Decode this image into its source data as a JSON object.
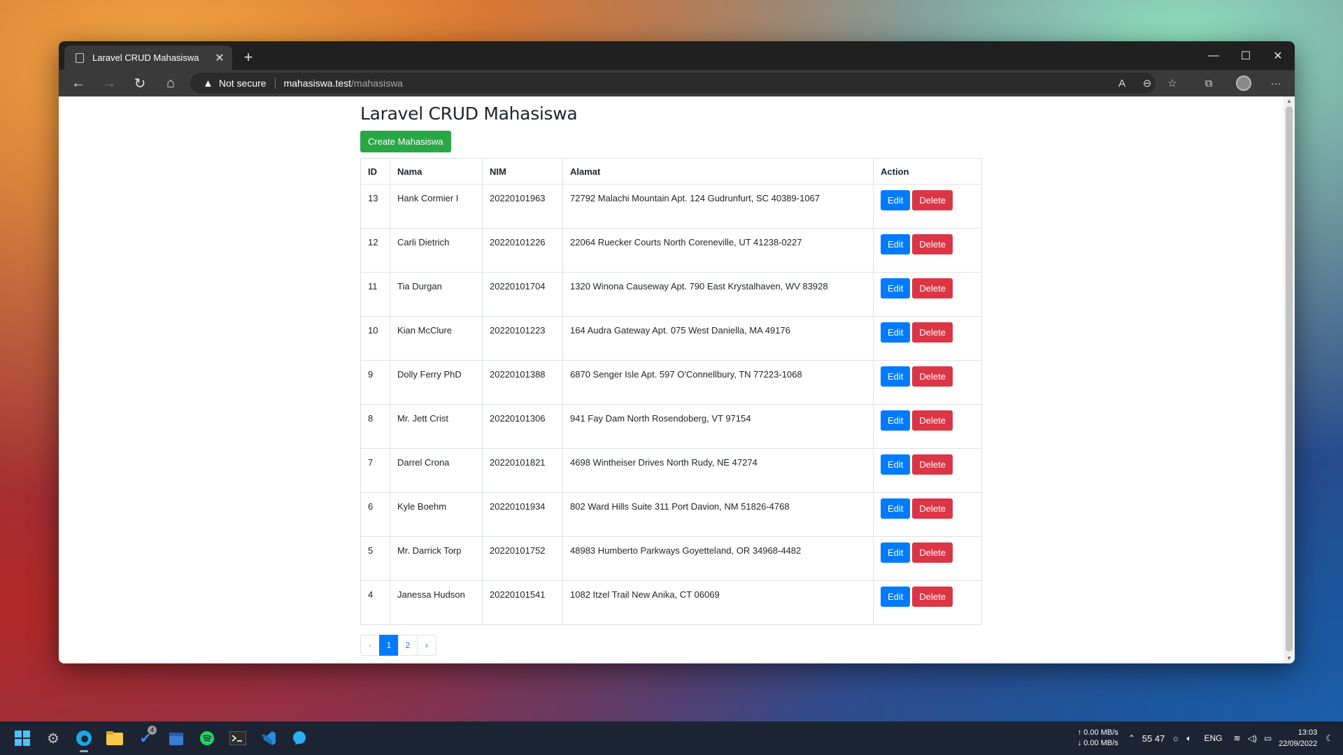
{
  "browser": {
    "tab_title": "Laravel CRUD Mahasiswa",
    "security_label": "Not secure",
    "url_host": "mahasiswa.test",
    "url_path": "/mahasiswa"
  },
  "page": {
    "title": "Laravel CRUD Mahasiswa",
    "create_button": "Create Mahasiswa",
    "columns": [
      "ID",
      "Nama",
      "NIM",
      "Alamat",
      "Action"
    ],
    "edit_label": "Edit",
    "delete_label": "Delete",
    "rows": [
      {
        "id": "13",
        "nama": "Hank Cormier I",
        "nim": "20220101963",
        "alamat": "72792 Malachi Mountain Apt. 124 Gudrunfurt, SC 40389-1067"
      },
      {
        "id": "12",
        "nama": "Carli Dietrich",
        "nim": "20220101226",
        "alamat": "22064 Ruecker Courts North Coreneville, UT 41238-0227"
      },
      {
        "id": "11",
        "nama": "Tia Durgan",
        "nim": "20220101704",
        "alamat": "1320 Winona Causeway Apt. 790 East Krystalhaven, WV 83928"
      },
      {
        "id": "10",
        "nama": "Kian McClure",
        "nim": "20220101223",
        "alamat": "164 Audra Gateway Apt. 075 West Daniella, MA 49176"
      },
      {
        "id": "9",
        "nama": "Dolly Ferry PhD",
        "nim": "20220101388",
        "alamat": "6870 Senger Isle Apt. 597 O'Connellbury, TN 77223-1068"
      },
      {
        "id": "8",
        "nama": "Mr. Jett Crist",
        "nim": "20220101306",
        "alamat": "941 Fay Dam North Rosendoberg, VT 97154"
      },
      {
        "id": "7",
        "nama": "Darrel Crona",
        "nim": "20220101821",
        "alamat": "4698 Wintheiser Drives North Rudy, NE 47274"
      },
      {
        "id": "6",
        "nama": "Kyle Boehm",
        "nim": "20220101934",
        "alamat": "802 Ward Hills Suite 311 Port Davion, NM 51826-4768"
      },
      {
        "id": "5",
        "nama": "Mr. Darrick Torp",
        "nim": "20220101752",
        "alamat": "48983 Humberto Parkways Goyetteland, OR 34968-4482"
      },
      {
        "id": "4",
        "nama": "Janessa Hudson",
        "nim": "20220101541",
        "alamat": "1082 Itzel Trail New Anika, CT 06069"
      }
    ],
    "pagination": {
      "prev": "‹",
      "pages": [
        "1",
        "2"
      ],
      "current": "1",
      "next": "›"
    }
  },
  "taskbar": {
    "upload": "↑  0.00 MB/s",
    "download": "↓  0.00 MB/s",
    "temps": "55  47",
    "language": "ENG",
    "time": "13:03",
    "date": "22/09/2022",
    "todo_badge": "4"
  }
}
